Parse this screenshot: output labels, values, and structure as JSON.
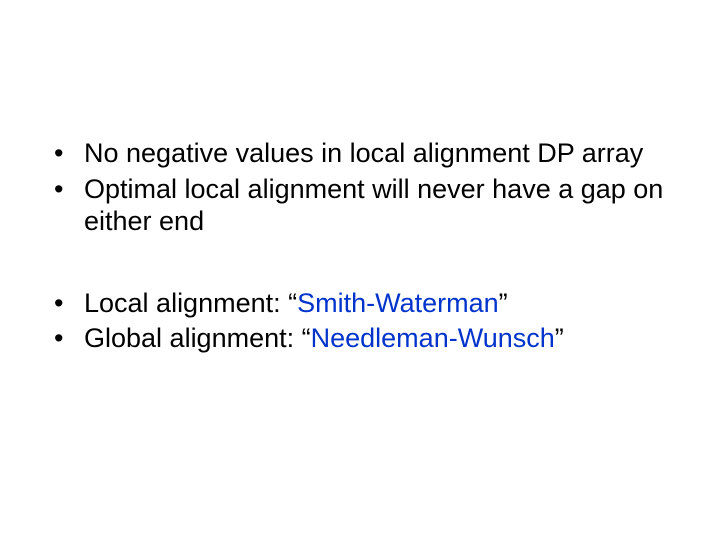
{
  "bullets_group1": [
    "No negative values in local alignment DP array",
    "Optimal local alignment will never have a gap on either end"
  ],
  "bullets_group2": [
    {
      "prefix": "Local alignment: “",
      "highlight": "Smith-Waterman",
      "suffix": "”"
    },
    {
      "prefix": "Global alignment: “",
      "highlight": "Needleman-Wunsch",
      "suffix": "”"
    }
  ],
  "bullet_glyph": "•"
}
